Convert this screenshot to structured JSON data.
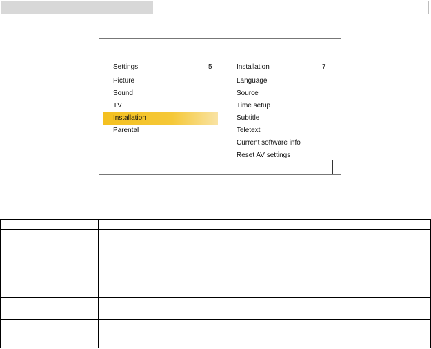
{
  "top_bar": {
    "progress_fraction": 0.355
  },
  "osd": {
    "left_panel": {
      "title": "Settings",
      "count": "5",
      "items": [
        "Picture",
        "Sound",
        "TV",
        "Installation",
        "Parental"
      ],
      "selected_index": 3
    },
    "right_panel": {
      "title": "Installation",
      "count": "7",
      "items": [
        "Language",
        "Source",
        "Time setup",
        "Subtitle",
        "Teletext",
        "Current software info",
        "Reset AV settings"
      ]
    },
    "colors": {
      "highlight": "#f4c020"
    }
  },
  "table": {
    "rows": [
      [
        "",
        ""
      ],
      [
        "",
        ""
      ],
      [
        "",
        ""
      ],
      [
        "",
        ""
      ]
    ]
  }
}
